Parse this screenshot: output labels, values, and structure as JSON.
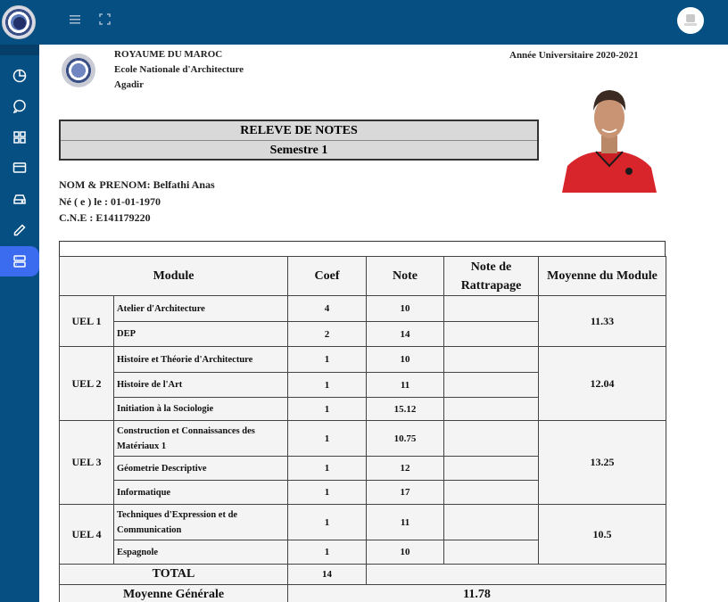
{
  "header": {
    "menu_icon": "hamburger-icon",
    "fullscreen_icon": "fullscreen-icon",
    "user_avatar_icon": "user-avatar-icon",
    "colors": {
      "bar": "#064f82",
      "active": "#3b6cf0"
    }
  },
  "sidebar": {
    "items": [
      {
        "icon": "pie-chart-icon"
      },
      {
        "icon": "chat-icon"
      },
      {
        "icon": "grid-icon"
      },
      {
        "icon": "card-icon"
      },
      {
        "icon": "drive-icon"
      },
      {
        "icon": "pencil-icon"
      },
      {
        "icon": "server-icon",
        "active": true
      }
    ]
  },
  "document": {
    "institution": [
      "ROYAUME DU MAROC",
      "Ecole Nationale d'Architecture",
      "Agadir"
    ],
    "academic_year": "Année Universitaire 2020-2021",
    "title": "RELEVE DE NOTES",
    "semester": "Semestre 1",
    "student": {
      "name": "NOM & PRENOM: Belfathi Anas",
      "birth": "Né ( e ) le : 01-01-1970",
      "cne": "C.N.E : E141179220"
    },
    "table": {
      "headers": {
        "module": "Module",
        "coef": "Coef",
        "note": "Note",
        "rattrapage": "Note de Rattrapage",
        "moyenne": "Moyenne du Module"
      },
      "units": [
        {
          "label": "UEL 1",
          "average": "11.33",
          "modules": [
            {
              "name": "Atelier d'Architecture",
              "coef": "4",
              "note": "10"
            },
            {
              "name": "DEP",
              "coef": "2",
              "note": "14"
            }
          ]
        },
        {
          "label": "UEL 2",
          "average": "12.04",
          "modules": [
            {
              "name": "Histoire et Théorie d'Architecture",
              "coef": "1",
              "note": "10"
            },
            {
              "name": "Histoire de l'Art",
              "coef": "1",
              "note": "11"
            },
            {
              "name": "Initiation à la Sociologie",
              "coef": "1",
              "note": "15.12"
            }
          ]
        },
        {
          "label": "UEL 3",
          "average": "13.25",
          "modules": [
            {
              "name": "Construction et Connaissances des Matériaux 1",
              "coef": "1",
              "note": "10.75"
            },
            {
              "name": "Géometrie Descriptive",
              "coef": "1",
              "note": "12"
            },
            {
              "name": "Informatique",
              "coef": "1",
              "note": "17"
            }
          ]
        },
        {
          "label": "UEL 4",
          "average": "10.5",
          "modules": [
            {
              "name": "Techniques d'Expression et de Communication",
              "coef": "1",
              "note": "11"
            },
            {
              "name": "Espagnole",
              "coef": "1",
              "note": "10"
            }
          ]
        }
      ],
      "total_label": "TOTAL",
      "total_coef": "14",
      "general_label": "Moyenne Générale",
      "general_value": "11.78"
    }
  }
}
